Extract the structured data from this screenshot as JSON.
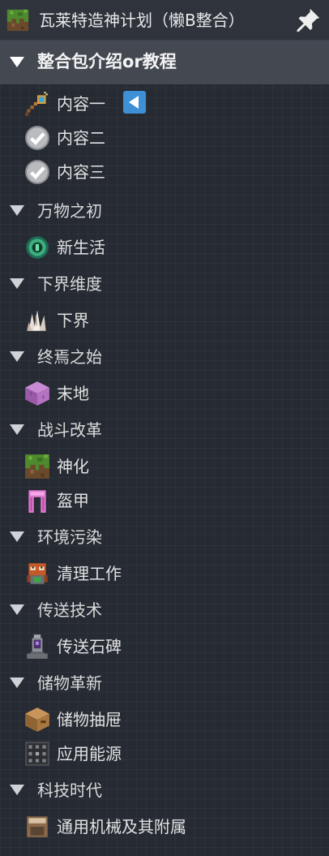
{
  "title": "瓦莱特造神计划（懒B整合）",
  "title_icon": "grass-block-icon",
  "pin_icon": "pin-icon",
  "sections": [
    {
      "label": "整合包介绍or教程",
      "active": true,
      "items": [
        {
          "label": "内容一",
          "icon": "magic-wand-icon",
          "current": true
        },
        {
          "label": "内容二",
          "icon": "checkmark-circle-icon"
        },
        {
          "label": "内容三",
          "icon": "checkmark-circle-icon"
        }
      ]
    },
    {
      "label": "万物之初",
      "items": [
        {
          "label": "新生活",
          "icon": "ender-eye-icon"
        }
      ]
    },
    {
      "label": "下界维度",
      "items": [
        {
          "label": "下界",
          "icon": "nether-quartz-icon"
        }
      ]
    },
    {
      "label": "终焉之始",
      "items": [
        {
          "label": "末地",
          "icon": "purpur-block-icon"
        }
      ]
    },
    {
      "label": "战斗改革",
      "items": [
        {
          "label": "神化",
          "icon": "grass-block-icon"
        },
        {
          "label": "盔甲",
          "icon": "leggings-icon"
        }
      ]
    },
    {
      "label": "环境污染",
      "items": [
        {
          "label": "清理工作",
          "icon": "robot-icon"
        }
      ]
    },
    {
      "label": "传送技术",
      "items": [
        {
          "label": "传送石碑",
          "icon": "teleport-stone-icon"
        }
      ]
    },
    {
      "label": "储物革新",
      "items": [
        {
          "label": "储物抽屉",
          "icon": "drawer-icon"
        },
        {
          "label": "应用能源",
          "icon": "me-block-icon"
        }
      ]
    },
    {
      "label": "科技时代",
      "items": [
        {
          "label": "通用机械及其附属",
          "icon": "machine-icon"
        }
      ]
    }
  ]
}
